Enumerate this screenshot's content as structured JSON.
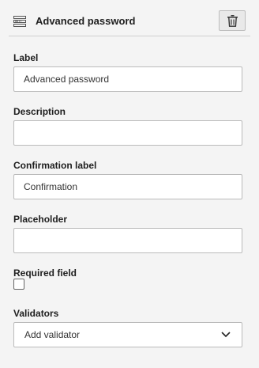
{
  "header": {
    "title": "Advanced password",
    "field_icon": "form-element-icon",
    "delete_icon": "trash-icon"
  },
  "fields": {
    "label": {
      "label": "Label",
      "value": "Advanced password"
    },
    "description": {
      "label": "Description",
      "value": ""
    },
    "confirmation_label": {
      "label": "Confirmation label",
      "value": "Confirmation"
    },
    "placeholder": {
      "label": "Placeholder",
      "value": ""
    }
  },
  "required": {
    "label": "Required field",
    "checked": false
  },
  "validators": {
    "label": "Validators",
    "value": "Add validator",
    "icon": "chevron-down-icon"
  }
}
